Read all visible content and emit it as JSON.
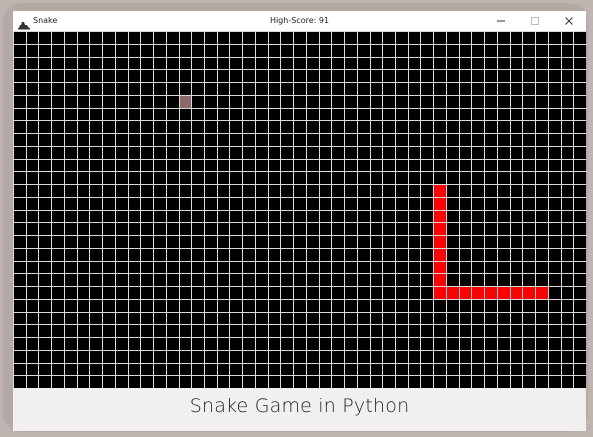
{
  "window": {
    "app_title": "Snake",
    "header_text": "High-Score: 91",
    "icon": "snake-app-icon",
    "controls": [
      "minimize-icon",
      "maximize-icon",
      "close-icon"
    ]
  },
  "game": {
    "grid_columns": 45,
    "grid_rows": 28,
    "background_color": "#000000",
    "grid_line_color": "#d9d9d9",
    "snake_color": "#ff0000",
    "food_color": "#8a6a6a",
    "food": {
      "col": 13,
      "row": 5
    },
    "snake": [
      {
        "col": 41,
        "row": 20
      },
      {
        "col": 40,
        "row": 20
      },
      {
        "col": 39,
        "row": 20
      },
      {
        "col": 38,
        "row": 20
      },
      {
        "col": 37,
        "row": 20
      },
      {
        "col": 36,
        "row": 20
      },
      {
        "col": 35,
        "row": 20
      },
      {
        "col": 34,
        "row": 20
      },
      {
        "col": 33,
        "row": 20
      },
      {
        "col": 33,
        "row": 19
      },
      {
        "col": 33,
        "row": 18
      },
      {
        "col": 33,
        "row": 17
      },
      {
        "col": 33,
        "row": 16
      },
      {
        "col": 33,
        "row": 15
      },
      {
        "col": 33,
        "row": 14
      },
      {
        "col": 33,
        "row": 13
      },
      {
        "col": 33,
        "row": 12
      }
    ]
  },
  "caption": "Snake Game in Python"
}
